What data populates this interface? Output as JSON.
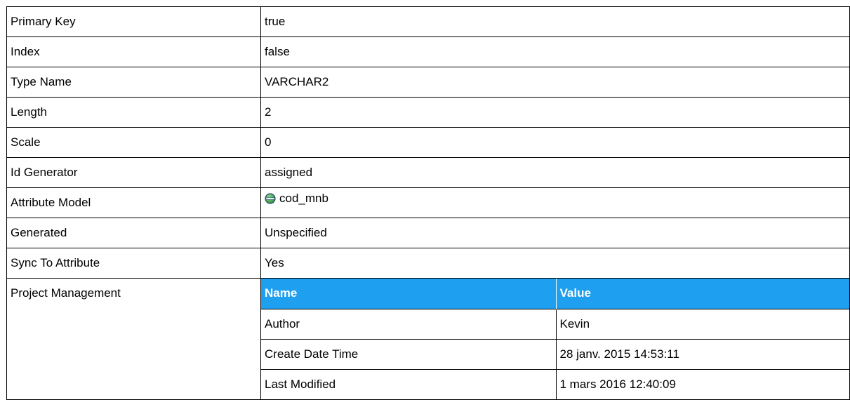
{
  "properties": [
    {
      "name": "Primary Key",
      "value": "true"
    },
    {
      "name": "Index",
      "value": "false"
    },
    {
      "name": "Type Name",
      "value": "VARCHAR2"
    },
    {
      "name": "Length",
      "value": "2"
    },
    {
      "name": "Scale",
      "value": "0"
    },
    {
      "name": "Id Generator",
      "value": "assigned"
    },
    {
      "name": "Attribute Model",
      "value": "cod_mnb",
      "icon": "attribute-model-icon"
    },
    {
      "name": "Generated",
      "value": "Unspecified"
    },
    {
      "name": "Sync To Attribute",
      "value": "Yes"
    }
  ],
  "project_management": {
    "label": "Project Management",
    "header": {
      "name": "Name",
      "value": "Value"
    },
    "rows": [
      {
        "name": "Author",
        "value": "Kevin"
      },
      {
        "name": "Create Date Time",
        "value": "28 janv. 2015 14:53:11"
      },
      {
        "name": "Last Modified",
        "value": "1 mars 2016 12:40:09"
      }
    ]
  },
  "colors": {
    "header_bg": "#1e9ff0",
    "header_text": "#ffffff",
    "icon_green": "#3a9a3a"
  }
}
